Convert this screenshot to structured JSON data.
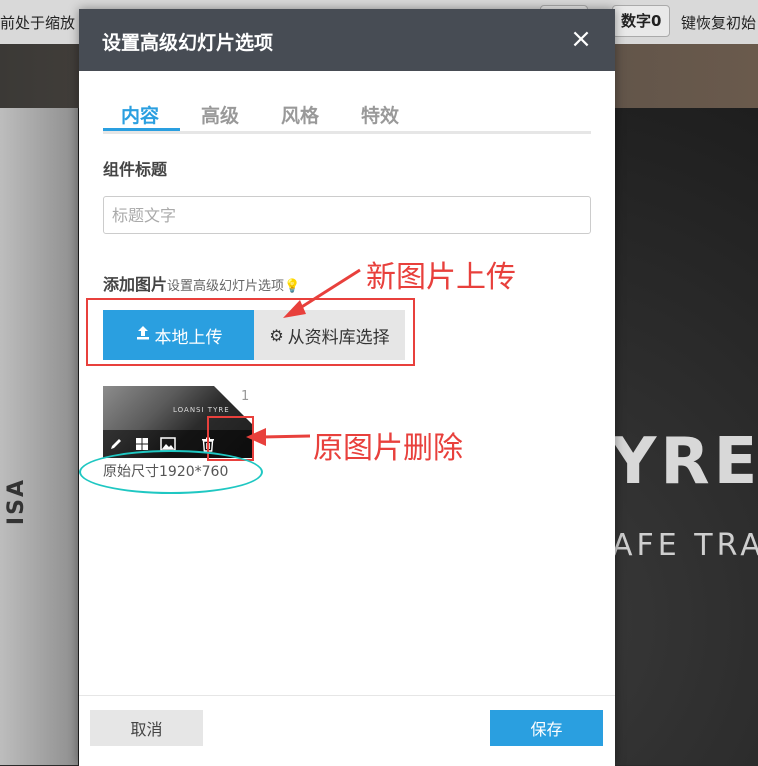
{
  "background": {
    "top_left_text": "前处于缩放",
    "top_key_label": "数字0",
    "top_right_text": "键恢复初始",
    "photo_car_text": "ISA",
    "photo_word_big": "YRE",
    "photo_word_small": "AFE TRA"
  },
  "dialog": {
    "title": "设置高级幻灯片选项",
    "close_icon": "×",
    "tabs": [
      {
        "label": "内容",
        "active": true
      },
      {
        "label": "高级",
        "active": false
      },
      {
        "label": "风格",
        "active": false
      },
      {
        "label": "特效",
        "active": false
      }
    ],
    "component_title_label": "组件标题",
    "title_input": {
      "value": "",
      "placeholder": "标题文字"
    },
    "add_image_label": "添加图片",
    "add_image_hint": "设置高级幻灯片选项",
    "upload_button": "本地上传",
    "library_button": "从资料库选择",
    "thumbnail": {
      "index": "1",
      "mini_text": "LOANSI TYRE",
      "original_size": "原始尺寸1920*760"
    },
    "footer": {
      "cancel": "取消",
      "save": "保存"
    }
  },
  "annotations": {
    "new_upload": "新图片上传",
    "delete_original": "原图片删除"
  },
  "colors": {
    "accent": "#2a9fe0",
    "header": "#474c54",
    "annotation_red": "#e8403c",
    "annotation_cyan": "#1fc7c2"
  }
}
